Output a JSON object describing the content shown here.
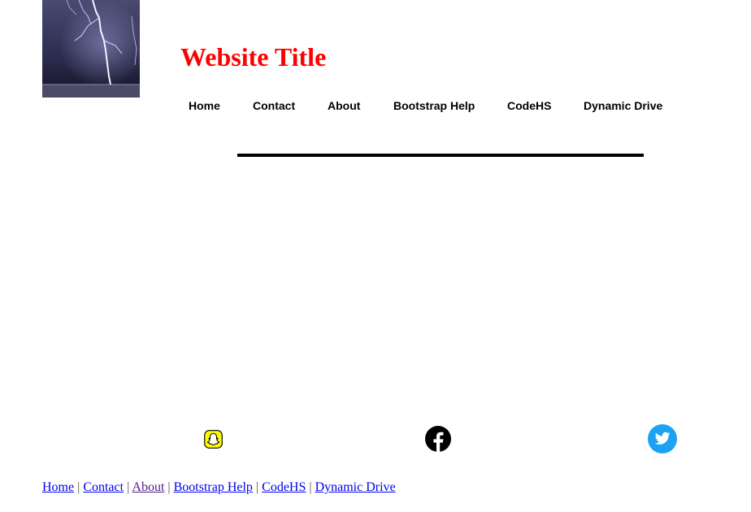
{
  "header": {
    "title": "Website Title",
    "title_color": "#ff0000",
    "logo_icon": "lightning-image"
  },
  "nav": {
    "items": [
      {
        "label": "Home"
      },
      {
        "label": "Contact"
      },
      {
        "label": "About"
      },
      {
        "label": "Bootstrap Help"
      },
      {
        "label": "CodeHS"
      },
      {
        "label": "Dynamic Drive"
      }
    ]
  },
  "social": {
    "icons": [
      "snapchat-icon",
      "facebook-icon",
      "twitter-icon"
    ],
    "colors": {
      "snapchat": "#fffc00",
      "facebook": "#000000",
      "twitter": "#1da1f2"
    }
  },
  "footer": {
    "separator": "|",
    "link_color": "#0000ee",
    "visited_color": "#551a8b",
    "links": [
      {
        "label": "Home"
      },
      {
        "label": "Contact"
      },
      {
        "label": "About"
      },
      {
        "label": "Bootstrap Help"
      },
      {
        "label": "CodeHS"
      },
      {
        "label": "Dynamic Drive"
      }
    ]
  }
}
